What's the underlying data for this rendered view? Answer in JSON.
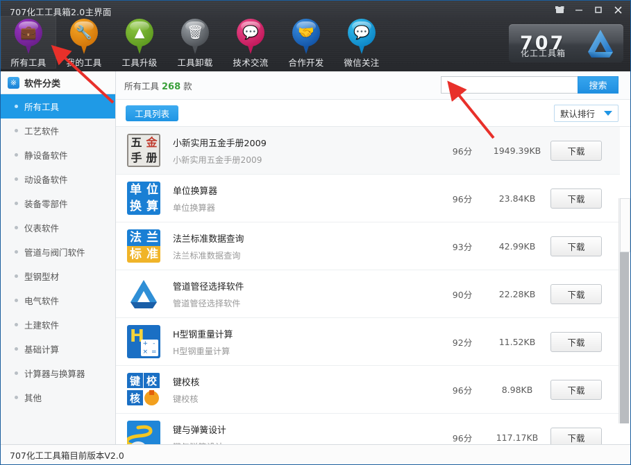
{
  "window": {
    "title": "707化工工具箱2.0主界面",
    "controls": {
      "skin": "shirt-icon",
      "minimize": "–",
      "maximize": "❐",
      "close": "✕"
    }
  },
  "toolbar": {
    "items": [
      {
        "label": "所有工具",
        "icon": "briefcase-icon",
        "glyph": "💼",
        "color": "#9b36c4",
        "color2": "#6b1f8c",
        "active": true
      },
      {
        "label": "我的工具",
        "icon": "tools-icon",
        "glyph": "🔧",
        "color": "#f6a623",
        "color2": "#d2760a",
        "active": false
      },
      {
        "label": "工具升级",
        "icon": "upgrade-arrow-icon",
        "glyph": "▲",
        "color": "#8bc53f",
        "color2": "#5e9a20",
        "active": false
      },
      {
        "label": "工具卸载",
        "icon": "trash-icon",
        "glyph": "🗑",
        "color": "#9aa0a6",
        "color2": "#4d5156",
        "active": false
      },
      {
        "label": "技术交流",
        "icon": "chat-icon",
        "glyph": "💬",
        "color": "#ef4f8d",
        "color2": "#c2185b",
        "active": false
      },
      {
        "label": "合作开发",
        "icon": "handshake-icon",
        "glyph": "🤝",
        "color": "#3a8fe0",
        "color2": "#1355a8",
        "active": false
      },
      {
        "label": "微信关注",
        "icon": "wechat-icon",
        "glyph": "💬",
        "color": "#35c0f0",
        "color2": "#0d86c6",
        "active": false
      }
    ]
  },
  "logo": {
    "number": "707",
    "subtitle": "化工工具箱"
  },
  "sidebar": {
    "header": "软件分类",
    "header_icon": "category-icon",
    "items": [
      {
        "label": "所有工具",
        "active": true
      },
      {
        "label": "工艺软件",
        "active": false
      },
      {
        "label": "静设备软件",
        "active": false
      },
      {
        "label": "动设备软件",
        "active": false
      },
      {
        "label": "装备零部件",
        "active": false
      },
      {
        "label": "仪表软件",
        "active": false
      },
      {
        "label": "管道与阀门软件",
        "active": false
      },
      {
        "label": "型钢型材",
        "active": false
      },
      {
        "label": "电气软件",
        "active": false
      },
      {
        "label": "土建软件",
        "active": false
      },
      {
        "label": "基础计算",
        "active": false
      },
      {
        "label": "计算器与换算器",
        "active": false
      },
      {
        "label": "其他",
        "active": false
      }
    ]
  },
  "main": {
    "crumb_prefix": "所有工具",
    "crumb_count": "268",
    "crumb_suffix": "款",
    "search": {
      "value": "",
      "placeholder": "",
      "button": "搜索"
    },
    "tab_label": "工具列表",
    "sort": {
      "label": "默认排行",
      "icon": "chevron-down-icon"
    },
    "download_label": "下载",
    "rows": [
      {
        "name": "小新实用五金手册2009",
        "desc": "小新实用五金手册2009",
        "score": "96分",
        "size": "1949.39KB",
        "icon": "app-icon-wujin",
        "icon_text": [
          "五",
          "金",
          "手",
          "册"
        ]
      },
      {
        "name": "单位换算器",
        "desc": "单位换算器",
        "score": "96分",
        "size": "23.84KB",
        "icon": "app-icon-danwei",
        "icon_text": [
          "单",
          "位",
          "换",
          "算"
        ]
      },
      {
        "name": "法兰标准数据查询",
        "desc": "法兰标准数据查询",
        "score": "93分",
        "size": "42.99KB",
        "icon": "app-icon-falan",
        "icon_text": [
          "法",
          "兰",
          "标",
          "准"
        ]
      },
      {
        "name": "管道管径选择软件",
        "desc": "管道管径选择软件",
        "score": "90分",
        "size": "22.28KB",
        "icon": "app-icon-guandao",
        "icon_text": []
      },
      {
        "name": "H型钢重量计算",
        "desc": "H型钢重量计算",
        "score": "92分",
        "size": "11.52KB",
        "icon": "app-icon-hsteel",
        "icon_text": []
      },
      {
        "name": "键校核",
        "desc": "键校核",
        "score": "96分",
        "size": "8.98KB",
        "icon": "app-icon-jianjiaohe",
        "icon_text": [
          "键",
          "校",
          "核"
        ]
      },
      {
        "name": "键与弹簧设计",
        "desc": "键与弹簧设计",
        "score": "96分",
        "size": "117.17KB",
        "icon": "app-icon-spring",
        "icon_text": []
      }
    ]
  },
  "footer": {
    "text": "707化工工具箱目前版本V2.0"
  },
  "colors": {
    "accent": "#1f95e4",
    "titlebar": "#2f3135",
    "count": "#3ba03b",
    "arrow": "#e8302a"
  }
}
